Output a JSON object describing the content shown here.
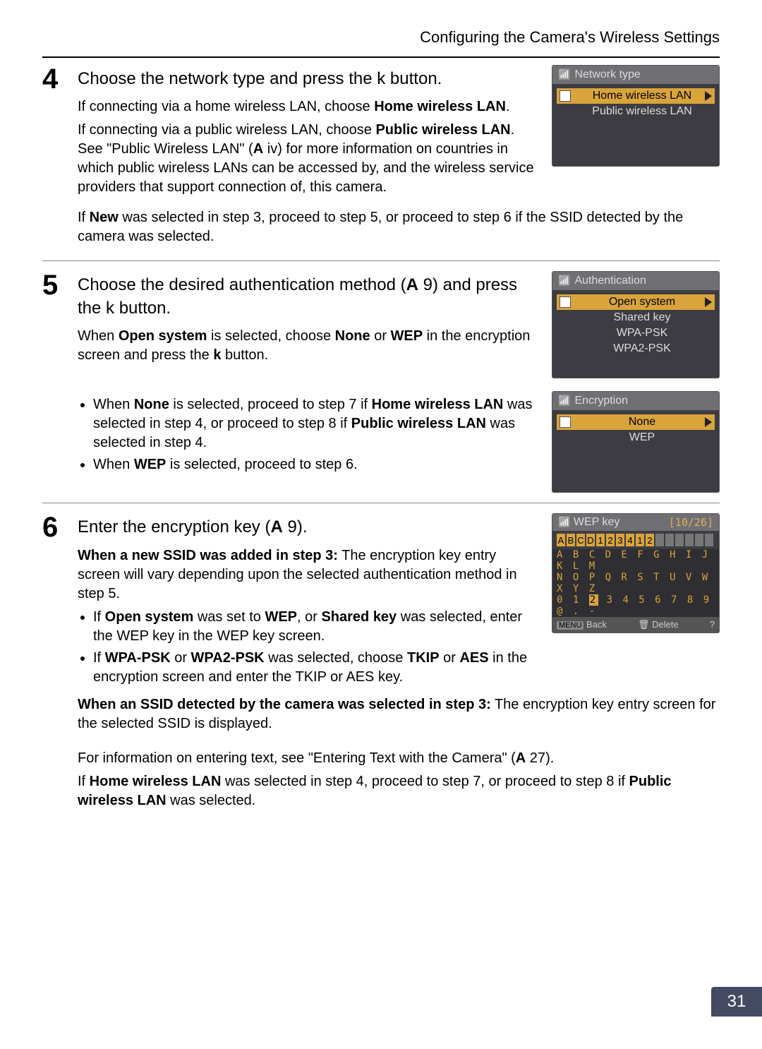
{
  "header": {
    "title": "Configuring the Camera's Wireless Settings"
  },
  "page_number": "31",
  "steps": {
    "s4": {
      "num": "4",
      "title_a": "Choose the network type and press the ",
      "title_k": "k",
      "title_b": " button.",
      "p1_a": "If connecting via a home wireless LAN, choose ",
      "p1_b": "Home wireless LAN",
      "p1_c": ".",
      "p2_a": "If connecting via a public wireless LAN, choose ",
      "p2_b": "Public wireless LAN",
      "p2_c": ". See \"Public Wireless LAN\" (",
      "p2_ref_book": "A",
      "p2_ref_page": " iv",
      "p2_d": ") for more information on countries in which public wireless LANs can be accessed by, and the wireless service providers that support connection of, this camera.",
      "p3_a": "If ",
      "p3_b": "New",
      "p3_c": " was selected in step 3, proceed to step 5, or proceed to step 6 if the SSID detected by the camera was selected.",
      "lcd": {
        "title": "Network type",
        "opt1": "Home wireless LAN",
        "opt2": "Public wireless LAN"
      }
    },
    "s5": {
      "num": "5",
      "title_a": "Choose the desired authentication method (",
      "title_ref_book": "A",
      "title_ref_page": " 9",
      "title_b": ") and press the ",
      "title_k": "k",
      "title_c": " button.",
      "p1_a": "When ",
      "p1_b": "Open system",
      "p1_c": " is selected, choose ",
      "p1_d": "None",
      "p1_e": " or ",
      "p1_f": "WEP",
      "p1_g": " in the encryption screen and press the ",
      "p1_k": "k",
      "p1_h": " button.",
      "b1_a": "When ",
      "b1_b": "None",
      "b1_c": " is selected, proceed to step 7 if ",
      "b1_d": "Home wireless LAN",
      "b1_e": " was selected in step 4, or proceed to step 8 if ",
      "b1_f": "Public wireless LAN",
      "b1_g": " was selected in step 4.",
      "b2_a": "When ",
      "b2_b": "WEP",
      "b2_c": " is selected, proceed to step 6.",
      "lcd1": {
        "title": "Authentication",
        "opt1": "Open system",
        "opt2": "Shared key",
        "opt3": "WPA-PSK",
        "opt4": "WPA2-PSK"
      },
      "lcd2": {
        "title": "Encryption",
        "opt1": "None",
        "opt2": "WEP"
      }
    },
    "s6": {
      "num": "6",
      "title_a": "Enter the encryption key (",
      "title_ref_book": "A",
      "title_ref_page": " 9",
      "title_b": ").",
      "p1_a": "When a new SSID was added in step 3:",
      "p1_b": " The encryption key entry screen will vary depending upon the selected authentication method in step 5.",
      "b1_a": "If ",
      "b1_b": "Open system",
      "b1_c": " was set to ",
      "b1_d": "WEP",
      "b1_e": ", or ",
      "b1_f": "Shared key",
      "b1_g": " was selected, enter the WEP key in the WEP key screen.",
      "b2_a": "If ",
      "b2_b": "WPA-PSK",
      "b2_c": " or ",
      "b2_d": "WPA2-PSK",
      "b2_e": " was selected, choose ",
      "b2_f": "TKIP",
      "b2_g": " or ",
      "b2_h": "AES",
      "b2_i": " in the encryption screen and enter the TKIP or AES key.",
      "p2_a": "When an SSID detected by the camera was selected in step 3:",
      "p2_b": " The encryption key entry screen for the selected SSID is displayed.",
      "p3_a": "For information on entering text, see \"Entering Text with the Camera\" (",
      "p3_ref_book": "A",
      "p3_ref_page": " 27",
      "p3_b": ").",
      "p4_a": "If ",
      "p4_b": "Home wireless LAN",
      "p4_c": " was selected in step 4, proceed to step 7, or proceed to step 8 if ",
      "p4_d": "Public wireless LAN",
      "p4_e": " was selected.",
      "lcd": {
        "title": "WEP key",
        "counter": "[10/26]",
        "entered": "ABCD123412",
        "row1": "A B C D E F G H I J K L M",
        "row2": "N O P Q R S T U V W X Y Z",
        "row3_pre": "0 1 ",
        "row3_hot": "2",
        "row3_post": " 3 4 5 6 7 8 9 @ . - ",
        "footer_back_tag": "MENU",
        "footer_back": "Back",
        "footer_del": "Delete"
      }
    }
  }
}
